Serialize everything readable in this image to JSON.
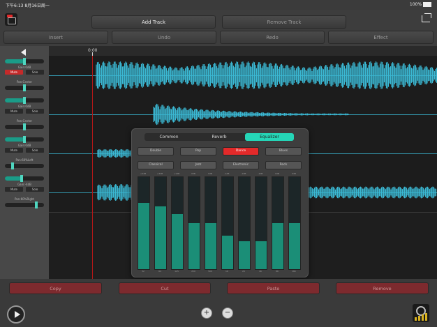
{
  "status": {
    "time": "下午6:13",
    "date": "8月16日周一",
    "battery": "100%"
  },
  "toolbar": {
    "add_track": "Add Track",
    "remove_track": "Remove Track"
  },
  "edit_bar": {
    "insert": "Insert",
    "undo": "Undo",
    "redo": "Redo",
    "effect": "Effect"
  },
  "timeline": {
    "start_time": "0:00"
  },
  "tracks": [
    {
      "gain": "Gain:0dB",
      "pan": "Pan:Center",
      "mute": "Mute",
      "solo": "Solo",
      "mute_active": true,
      "gain_level": 0.5,
      "pan_level": 0.5
    },
    {
      "gain": "Gain:0dB",
      "pan": "Pan:Center",
      "mute": "Mute",
      "solo": "Solo",
      "mute_active": false,
      "gain_level": 0.5,
      "pan_level": 0.5
    },
    {
      "gain": "Gain:0dB",
      "pan": "Pan:60%Left",
      "mute": "Mute",
      "solo": "Solo",
      "mute_active": false,
      "gain_level": 0.5,
      "pan_level": 0.2
    },
    {
      "gain": "Gain:-4dB",
      "pan": "Pan:60%Right",
      "mute": "Mute",
      "solo": "Solo",
      "mute_active": false,
      "gain_level": 0.42,
      "pan_level": 0.8
    }
  ],
  "effects": {
    "tabs": [
      "Common",
      "Reverb",
      "Equalizer"
    ],
    "active_tab": "Equalizer",
    "presets": [
      "Double",
      "Pop",
      "Dance",
      "Blues",
      "Classical",
      "Jazz",
      "Electronic",
      "Rock"
    ],
    "active_preset": "Dance",
    "bands": [
      {
        "value": "+4dB",
        "freq": "32",
        "level": 0.72
      },
      {
        "value": "+3dB",
        "freq": "64",
        "level": 0.68
      },
      {
        "value": "+1dB",
        "freq": "125",
        "level": 0.6
      },
      {
        "value": "0dB",
        "freq": "250",
        "level": 0.5
      },
      {
        "value": "0dB",
        "freq": "500",
        "level": 0.5
      },
      {
        "value": "-1dB",
        "freq": "1K",
        "level": 0.36
      },
      {
        "value": "-2dB",
        "freq": "2K",
        "level": 0.3
      },
      {
        "value": "-2dB",
        "freq": "4K",
        "level": 0.3
      },
      {
        "value": "0dB",
        "freq": "8K",
        "level": 0.5
      },
      {
        "value": "0dB",
        "freq": "16K",
        "level": 0.5
      }
    ]
  },
  "clipboard": {
    "copy": "Copy",
    "cut": "Cut",
    "paste": "Paste",
    "remove": "Remove"
  },
  "colors": {
    "waveform": "#3bb9d4",
    "accent": "#25d6b7",
    "active": "#e32a2a",
    "button_red": "#7d2a2e"
  }
}
